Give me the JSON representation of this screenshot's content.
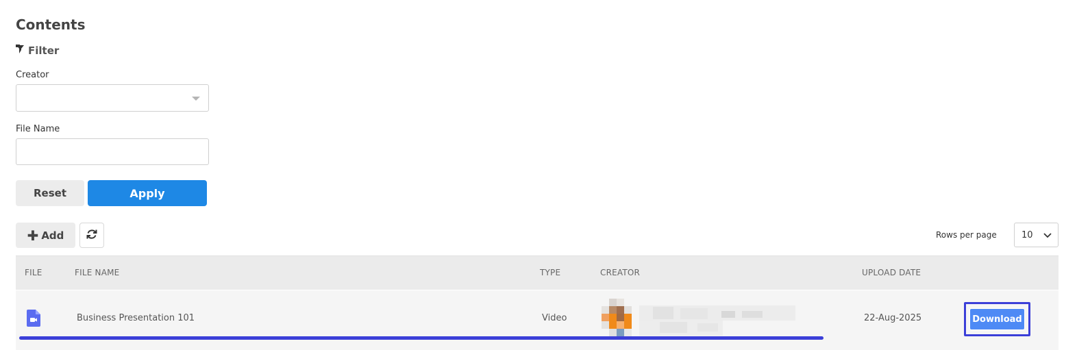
{
  "page": {
    "title": "Contents"
  },
  "filter": {
    "heading": "Filter",
    "creator_label": "Creator",
    "creator_value": "",
    "file_name_label": "File Name",
    "file_name_value": "",
    "file_name_placeholder": "",
    "reset_label": "Reset",
    "apply_label": "Apply"
  },
  "toolbar": {
    "add_label": "Add",
    "rows_per_page_label": "Rows per page",
    "rows_per_page_value": "10"
  },
  "table": {
    "columns": [
      "FILE",
      "FILE NAME",
      "TYPE",
      "CREATOR",
      "UPLOAD DATE"
    ],
    "rows": [
      {
        "file_icon": "video-file-icon",
        "file_name": "Business Presentation 101",
        "type": "Video",
        "creator": "",
        "upload_date": "22-Aug-2025",
        "action_label": "Download"
      }
    ]
  },
  "colors": {
    "primary": "#1e88e5",
    "download": "#4e8af5",
    "highlight": "#3b3fd8",
    "file_icon": "#5b6cf0"
  }
}
